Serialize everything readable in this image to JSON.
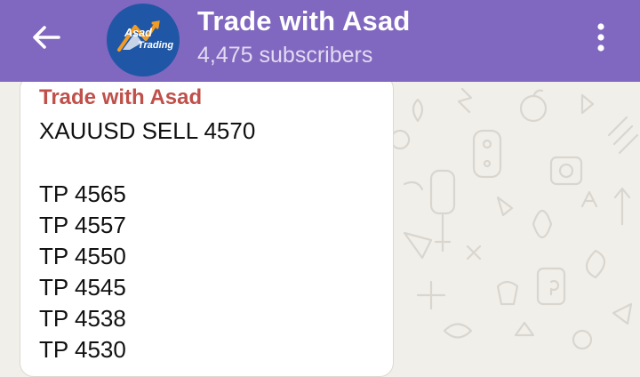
{
  "header": {
    "title": "Trade with Asad",
    "subscribers": "4,475 subscribers",
    "back_icon": "back-arrow-icon",
    "menu_icon": "kebab-menu-icon",
    "avatar_logo": {
      "line1": "Asad",
      "line2": "Trading"
    }
  },
  "message": {
    "sender": "Trade with Asad",
    "lines": [
      "XAUUSD SELL 4570",
      "",
      "TP 4565",
      "TP 4557",
      "TP 4550",
      "TP 4545",
      "TP 4538",
      "TP 4530"
    ]
  },
  "colors": {
    "header_bg": "#8067bf",
    "sender_name": "#c0504a",
    "chat_bg": "#f1efe9"
  }
}
